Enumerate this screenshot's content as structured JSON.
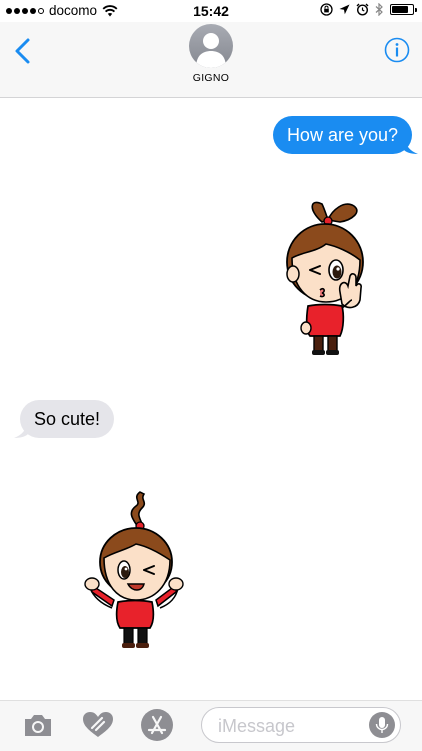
{
  "status_bar": {
    "carrier": "docomo",
    "time": "15:42",
    "battery_level": 0.8
  },
  "header": {
    "contact_name": "GIGNO",
    "back_icon": "chevron-left-icon",
    "info_icon": "info-icon",
    "accent_color": "#1a8cf1"
  },
  "messages": [
    {
      "direction": "outgoing",
      "text": "How are you?"
    },
    {
      "direction": "outgoing",
      "sticker": "girl-winking-waving-sticker"
    },
    {
      "direction": "incoming",
      "text": "So cute!"
    },
    {
      "direction": "incoming",
      "sticker": "girl-cheering-sticker"
    }
  ],
  "input_bar": {
    "placeholder": "iMessage",
    "tools": [
      "camera-icon",
      "digital-touch-icon",
      "app-store-icon"
    ],
    "mic_icon": "microphone-icon"
  }
}
